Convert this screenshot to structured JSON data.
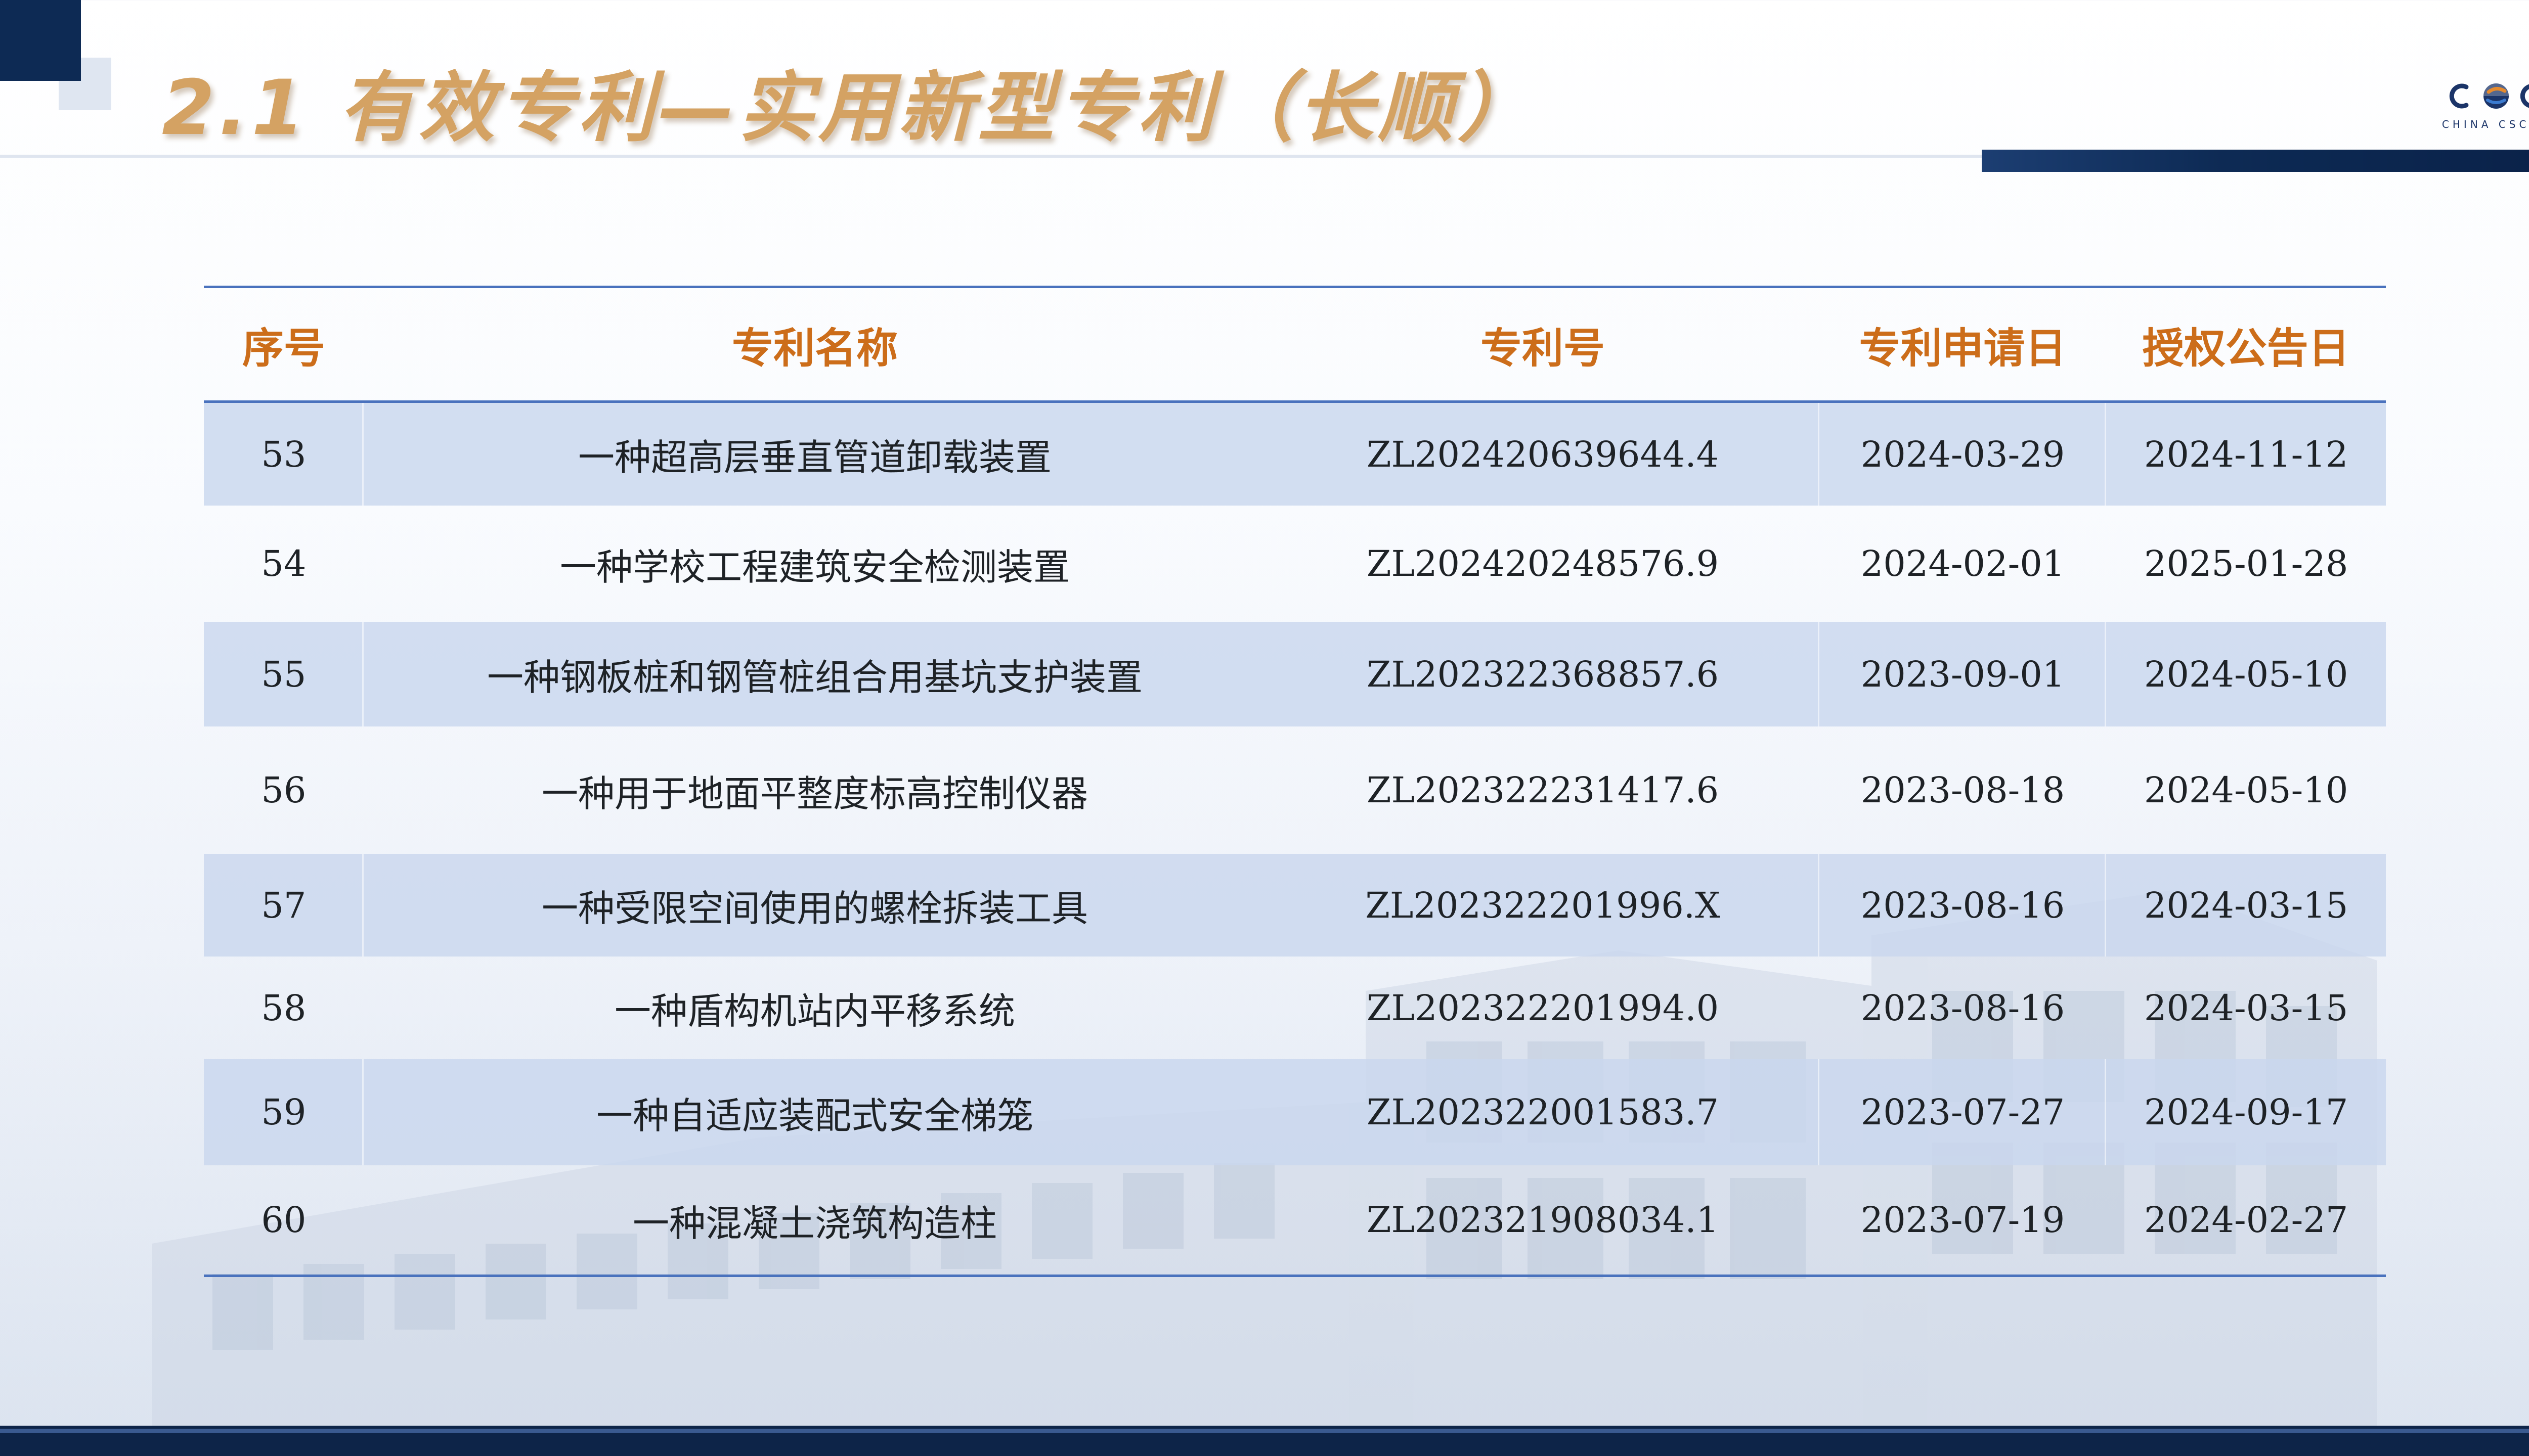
{
  "title": "2.1 有效专利—实用新型专利（长顺）",
  "logo": {
    "text": "CSCEC",
    "subtext": "CHINA CSCEC"
  },
  "table": {
    "headers": [
      "序号",
      "专利名称",
      "专利号",
      "专利申请日",
      "授权公告日"
    ],
    "rows": [
      [
        "53",
        "一种超高层垂直管道卸载装置",
        "ZL202420639644.4",
        "2024-03-29",
        "2024-11-12"
      ],
      [
        "54",
        "一种学校工程建筑安全检测装置",
        "ZL202420248576.9",
        "2024-02-01",
        "2025-01-28"
      ],
      [
        "55",
        "一种钢板桩和钢管桩组合用基坑支护装置",
        "ZL202322368857.6",
        "2023-09-01",
        "2024-05-10"
      ],
      [
        "56",
        "一种用于地面平整度标高控制仪器",
        "ZL202322231417.6",
        "2023-08-18",
        "2024-05-10"
      ],
      [
        "57",
        "一种受限空间使用的螺栓拆装工具",
        "ZL202322201996.X",
        "2023-08-16",
        "2024-03-15"
      ],
      [
        "58",
        "一种盾构机站内平移系统",
        "ZL202322201994.0",
        "2023-08-16",
        "2024-03-15"
      ],
      [
        "59",
        "一种自适应装配式安全梯笼",
        "ZL202322001583.7",
        "2023-07-27",
        "2024-09-17"
      ],
      [
        "60",
        "一种混凝土浇筑构造柱",
        "ZL202321908034.1",
        "2023-07-19",
        "2024-02-27"
      ]
    ]
  },
  "colors": {
    "navy": "#0d2a54",
    "title_gold": "#d4a263",
    "header_orange": "#cc6d1a",
    "row_band": "#c9d7ee",
    "rule_blue": "#4a72bd"
  }
}
